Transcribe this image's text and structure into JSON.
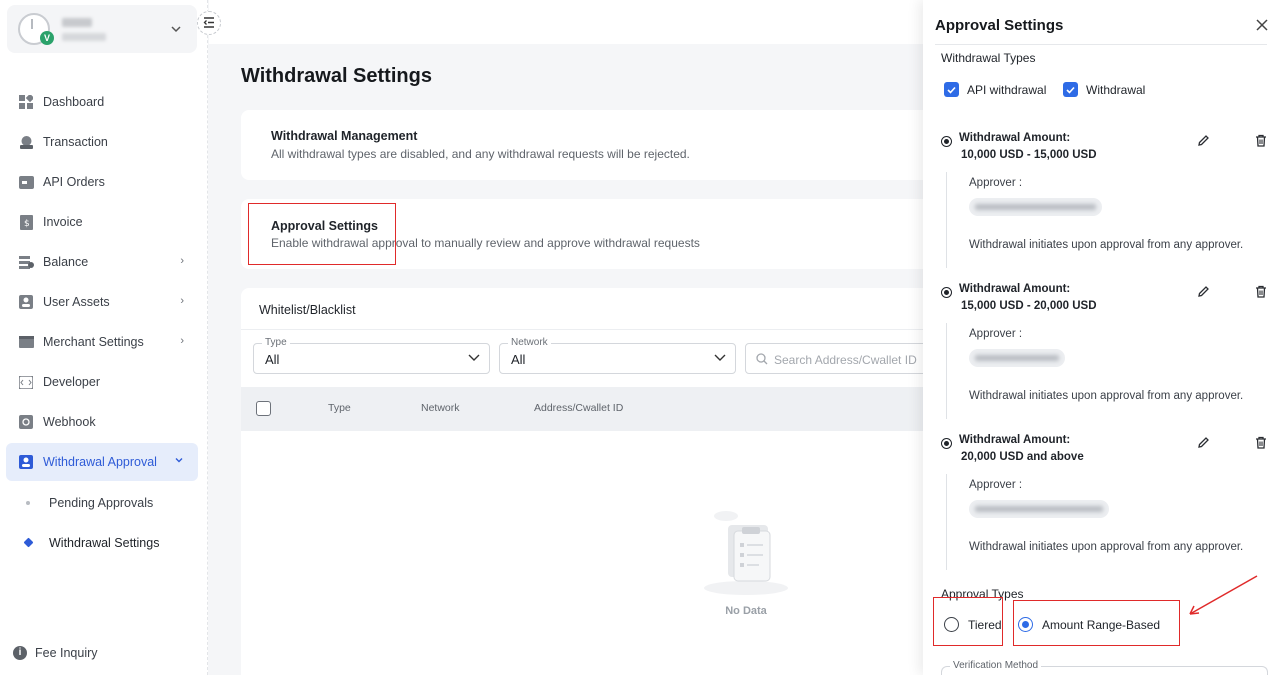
{
  "sidebar": {
    "items": [
      {
        "label": "Dashboard",
        "icon": "dashboard-icon"
      },
      {
        "label": "Transaction",
        "icon": "transaction-icon"
      },
      {
        "label": "API Orders",
        "icon": "api-orders-icon"
      },
      {
        "label": "Invoice",
        "icon": "invoice-icon"
      },
      {
        "label": "Balance",
        "icon": "balance-icon"
      },
      {
        "label": "User Assets",
        "icon": "user-assets-icon"
      },
      {
        "label": "Merchant Settings",
        "icon": "merchant-settings-icon"
      },
      {
        "label": "Developer",
        "icon": "developer-icon"
      },
      {
        "label": "Webhook",
        "icon": "webhook-icon"
      },
      {
        "label": "Withdrawal Approval",
        "icon": "withdrawal-approval-icon"
      }
    ],
    "sub_items": [
      {
        "label": "Pending Approvals"
      },
      {
        "label": "Withdrawal Settings"
      }
    ],
    "fee_inquiry": "Fee Inquiry",
    "account_badge": "V"
  },
  "main": {
    "title": "Withdrawal Settings",
    "management": {
      "title": "Withdrawal Management",
      "desc": "All withdrawal types are disabled, and any withdrawal requests will be rejected."
    },
    "approval": {
      "title": "Approval Settings",
      "desc": "Enable withdrawal approval to manually review and approve withdrawal requests"
    },
    "whitelist": {
      "title": "Whitelist/Blacklist",
      "type_label": "Type",
      "type_value": "All",
      "network_label": "Network",
      "network_value": "All",
      "search_placeholder": "Search Address/Cwallet ID",
      "columns": [
        "Type",
        "Network",
        "Address/Cwallet ID"
      ],
      "empty": "No Data"
    }
  },
  "drawer": {
    "title": "Approval Settings",
    "withdrawal_types_label": "Withdrawal Types",
    "withdrawal_types": [
      {
        "label": "API withdrawal",
        "checked": true
      },
      {
        "label": "Withdrawal",
        "checked": true
      }
    ],
    "tiers": [
      {
        "label": "Withdrawal Amount:",
        "range": "10,000 USD - 15,000 USD",
        "approver_label": "Approver :",
        "note": "Withdrawal initiates upon approval from any approver."
      },
      {
        "label": "Withdrawal Amount:",
        "range": "15,000 USD - 20,000 USD",
        "approver_label": "Approver :",
        "note": "Withdrawal initiates upon approval from any approver."
      },
      {
        "label": "Withdrawal Amount:",
        "range": "20,000 USD and above",
        "approver_label": "Approver :",
        "note": "Withdrawal initiates upon approval from any approver."
      }
    ],
    "approval_types_label": "Approval Types",
    "approval_types": [
      {
        "label": "Tiered",
        "selected": false
      },
      {
        "label": "Amount Range-Based",
        "selected": true
      }
    ],
    "verification_method_label": "Verification Method"
  },
  "colors": {
    "accent": "#2e6be6",
    "active_nav_bg": "#e6edfb",
    "highlight_box": "#e02a2a"
  }
}
